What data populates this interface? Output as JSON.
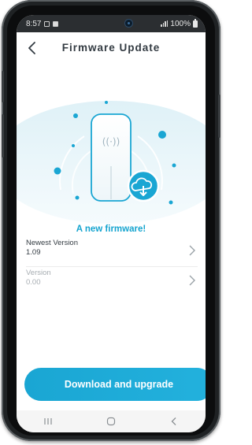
{
  "status_bar": {
    "time": "8:57",
    "battery_text": "100%",
    "icons": [
      "notification-icon",
      "gallery-icon",
      "signal-icon",
      "battery-icon"
    ]
  },
  "header": {
    "title": "Firmware Update",
    "back_icon": "chevron-left-icon"
  },
  "hero": {
    "device_icon": "wireless-extender-icon",
    "wifi_symbol": "((·))",
    "badge_icon": "cloud-download-icon"
  },
  "update": {
    "message": "A new firmware!",
    "rows": [
      {
        "label": "Newest Version",
        "value": "1.09"
      },
      {
        "label": "Version",
        "value": "0.00"
      }
    ]
  },
  "actions": {
    "download_label": "Download and upgrade"
  },
  "nav": {
    "recent": "recent-apps-icon",
    "home": "home-icon",
    "back": "back-icon"
  },
  "colors": {
    "accent": "#1aa6d3",
    "text": "#333b42",
    "muted": "#a7adb2"
  }
}
